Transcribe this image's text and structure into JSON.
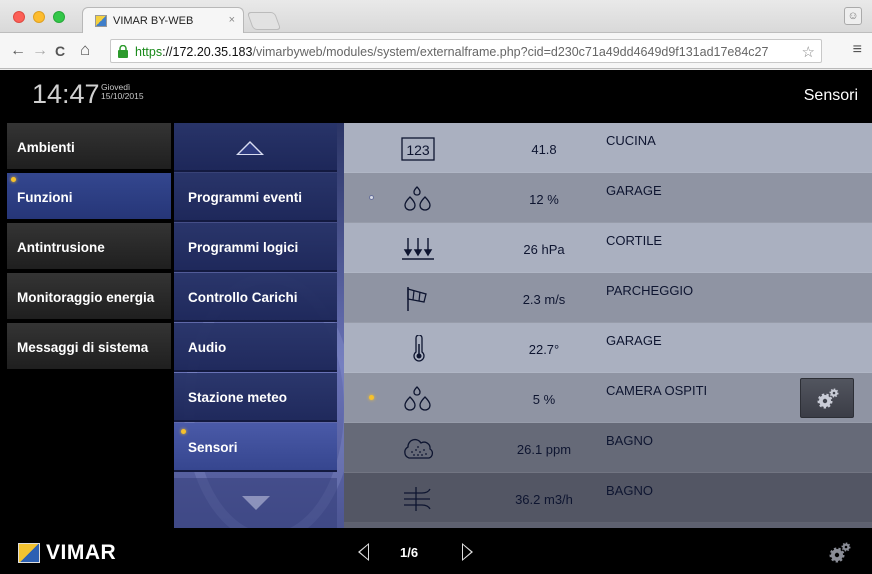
{
  "browser": {
    "tab_title": "VIMAR BY-WEB",
    "tab_close": "×",
    "url_scheme": "https",
    "url_host": "://172.20.35.183",
    "url_path": "/vimarbyweb/modules/system/externalframe.php?cid=d230c71a49dd4649d9f131ad17e84c27",
    "star": "☆",
    "menu": "≡",
    "back": "←",
    "forward": "→",
    "reload": "C",
    "home": "⌂"
  },
  "header": {
    "time": "14:47",
    "weekday": "Giovedì",
    "date": "15/10/2015",
    "page_title": "Sensori"
  },
  "left_nav": [
    {
      "label": "Ambienti",
      "active": false,
      "indicator": false
    },
    {
      "label": "Funzioni",
      "active": true,
      "indicator": true
    },
    {
      "label": "Antintrusione",
      "active": false,
      "indicator": false
    },
    {
      "label": "Monitoraggio energia",
      "active": false,
      "indicator": false
    },
    {
      "label": "Messaggi di sistema",
      "active": false,
      "indicator": false
    }
  ],
  "sub_nav": [
    {
      "label": "Programmi eventi",
      "active": false
    },
    {
      "label": "Programmi logici",
      "active": false
    },
    {
      "label": "Controllo Carichi",
      "active": false
    },
    {
      "label": "Audio",
      "active": false
    },
    {
      "label": "Stazione meteo",
      "active": false
    },
    {
      "label": "Sensori",
      "active": true
    }
  ],
  "sensors": [
    {
      "icon": "counter-icon",
      "value": "41.8",
      "room": "CUCINA",
      "dot": "none"
    },
    {
      "icon": "humidity-icon",
      "value": "12 %",
      "room": "GARAGE",
      "dot": "off"
    },
    {
      "icon": "pressure-icon",
      "value": "26 hPa",
      "room": "CORTILE",
      "dot": "none"
    },
    {
      "icon": "wind-sock-icon",
      "value": "2.3 m/s",
      "room": "PARCHEGGIO",
      "dot": "none"
    },
    {
      "icon": "thermometer-icon",
      "value": "22.7°",
      "room": "GARAGE",
      "dot": "none"
    },
    {
      "icon": "humidity-icon",
      "value": "5 %",
      "room": "CAMERA OSPITI",
      "dot": "on",
      "settings": true
    },
    {
      "icon": "air-quality-cloud-icon",
      "value": "26.1 ppm",
      "room": "BAGNO",
      "dot": "none"
    },
    {
      "icon": "air-flow-icon",
      "value": "36.2 m3/h",
      "room": "BAGNO",
      "dot": "none"
    }
  ],
  "footer": {
    "logo_text": "VIMAR",
    "page_indicator": "1/6"
  },
  "colors": {
    "accent_active": "#34478f",
    "indicator_yellow": "#f6c12b",
    "row_light": "#a9aebb",
    "row_dark": "#8a8f9e"
  }
}
